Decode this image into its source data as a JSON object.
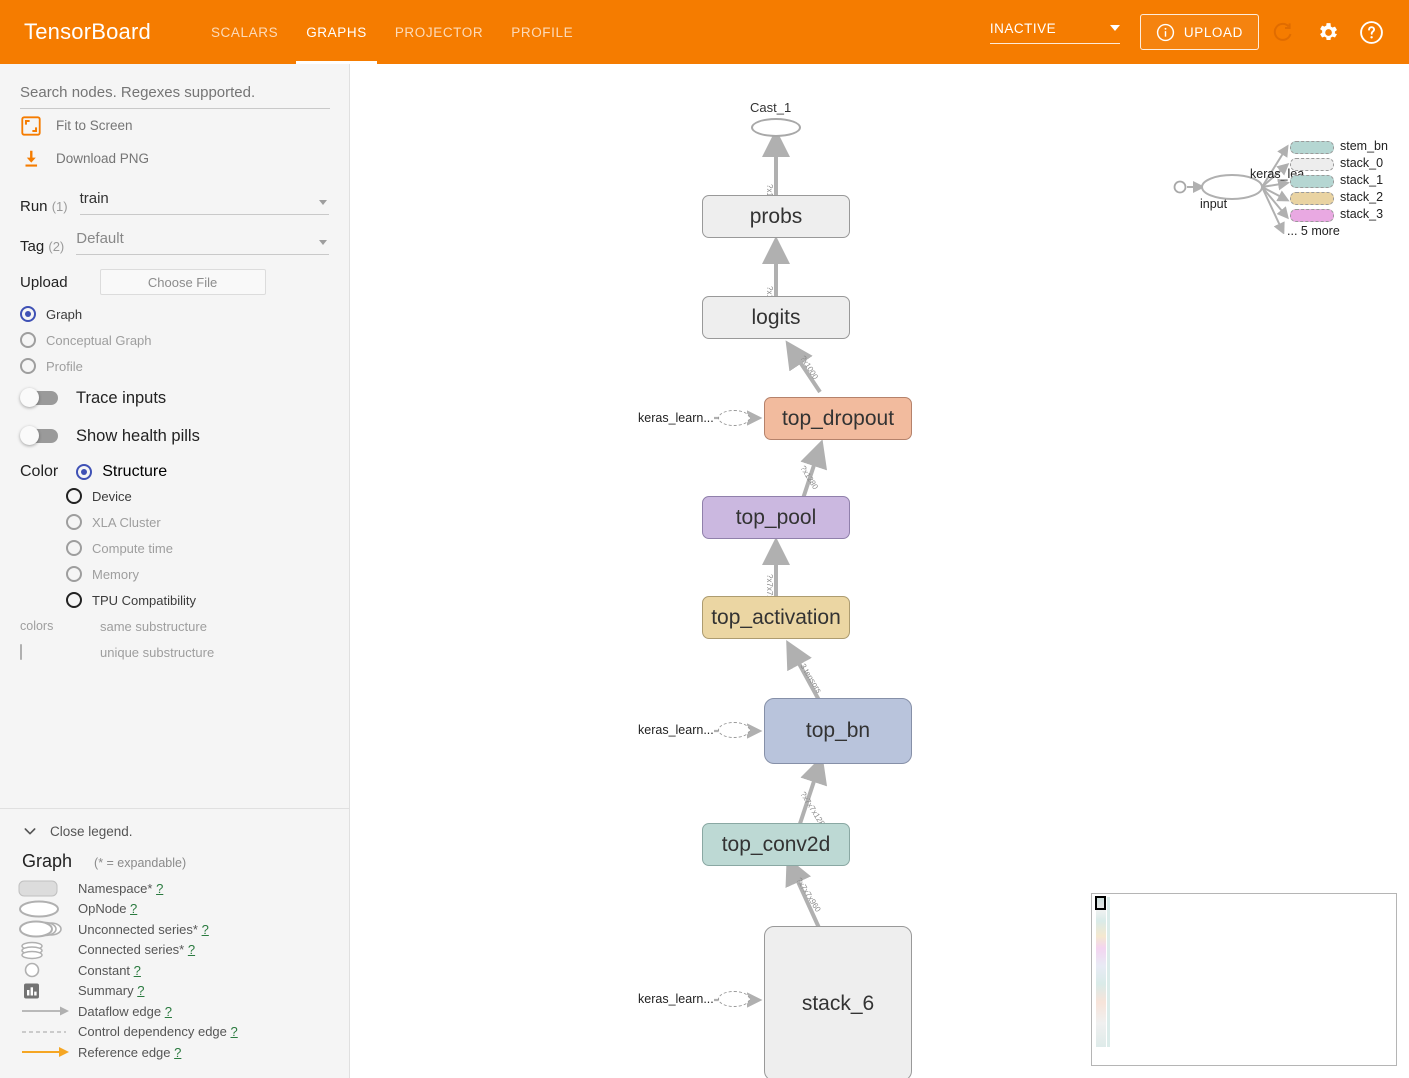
{
  "header": {
    "logo": "TensorBoard",
    "tabs": [
      {
        "label": "SCALARS",
        "active": false
      },
      {
        "label": "GRAPHS",
        "active": true
      },
      {
        "label": "PROJECTOR",
        "active": false
      },
      {
        "label": "PROFILE",
        "active": false
      }
    ],
    "status_select": "INACTIVE",
    "upload_label": "UPLOAD",
    "icons": [
      "info-icon",
      "refresh-icon",
      "gear-icon",
      "help-icon"
    ],
    "accent_color": "#f57c00"
  },
  "sidebar": {
    "search_placeholder": "Search nodes. Regexes supported.",
    "search_value": "",
    "fit_to_screen": "Fit to Screen",
    "download_png": "Download PNG",
    "run": {
      "label": "Run",
      "count": "(1)",
      "value": "train"
    },
    "tag": {
      "label": "Tag",
      "count": "(2)",
      "value": "Default"
    },
    "upload": {
      "title": "Upload",
      "choose_file": "Choose File"
    },
    "source_options": [
      {
        "label": "Graph",
        "checked": true,
        "enabled": true
      },
      {
        "label": "Conceptual Graph",
        "checked": false,
        "enabled": false
      },
      {
        "label": "Profile",
        "checked": false,
        "enabled": false
      }
    ],
    "toggles": [
      {
        "label": "Trace inputs",
        "on": false
      },
      {
        "label": "Show health pills",
        "on": false
      }
    ],
    "color": {
      "title": "Color",
      "options": [
        {
          "label": "Structure",
          "checked": true,
          "enabled": true
        },
        {
          "label": "Device",
          "checked": false,
          "enabled": true
        },
        {
          "label": "XLA Cluster",
          "checked": false,
          "enabled": false
        },
        {
          "label": "Compute time",
          "checked": false,
          "enabled": false
        },
        {
          "label": "Memory",
          "checked": false,
          "enabled": false
        },
        {
          "label": "TPU Compatibility",
          "checked": false,
          "enabled": true
        }
      ],
      "swatch_key": "colors",
      "same_substructure": "same substructure",
      "unique_substructure": "unique substructure"
    }
  },
  "legend": {
    "close_label": "Close legend.",
    "title": "Graph",
    "subtitle": "(* = expandable)",
    "items": [
      {
        "icon": "namespace-icon",
        "text": "Namespace*",
        "help": "?"
      },
      {
        "icon": "opnode-icon",
        "text": "OpNode",
        "help": "?"
      },
      {
        "icon": "unconnected-series-icon",
        "text": "Unconnected series*",
        "help": "?"
      },
      {
        "icon": "connected-series-icon",
        "text": "Connected series*",
        "help": "?"
      },
      {
        "icon": "constant-icon",
        "text": "Constant",
        "help": "?"
      },
      {
        "icon": "summary-icon",
        "text": "Summary",
        "help": "?"
      },
      {
        "icon": "dataflow-edge-icon",
        "text": "Dataflow edge",
        "help": "?"
      },
      {
        "icon": "control-dependency-edge-icon",
        "text": "Control dependency edge",
        "help": "?"
      },
      {
        "icon": "reference-edge-icon",
        "text": "Reference edge",
        "help": "?"
      }
    ]
  },
  "graph": {
    "nodes": [
      {
        "id": "cast_1",
        "label": "Cast_1",
        "type": "op",
        "color": "#ffffff"
      },
      {
        "id": "probs",
        "label": "probs",
        "type": "namespace",
        "color": "#eeeeee"
      },
      {
        "id": "logits",
        "label": "logits",
        "type": "namespace",
        "color": "#eeeeee"
      },
      {
        "id": "top_dropout",
        "label": "top_dropout",
        "type": "namespace",
        "color": "#f2bb9e"
      },
      {
        "id": "top_pool",
        "label": "top_pool",
        "type": "namespace",
        "color": "#cbb8e0"
      },
      {
        "id": "top_activation",
        "label": "top_activation",
        "type": "namespace",
        "color": "#ebd6a3"
      },
      {
        "id": "top_bn",
        "label": "top_bn",
        "type": "namespace",
        "color": "#b9c4dc"
      },
      {
        "id": "top_conv2d",
        "label": "top_conv2d",
        "type": "namespace",
        "color": "#bdd9d4"
      },
      {
        "id": "stack_6",
        "label": "stack_6",
        "type": "namespace",
        "color": "#eeeeee"
      }
    ],
    "edge_labels": [
      "?x1000",
      "?x1000",
      "?x1000",
      "?x1280",
      "?x1280",
      "?x7x7x1280",
      "3 tensors",
      "?x7x7x1280",
      "?x7x7x960"
    ],
    "input_stubs": [
      {
        "label": "keras_learn...",
        "target": "top_dropout"
      },
      {
        "label": "keras_learn...",
        "target": "top_bn"
      },
      {
        "label": "keras_learn...",
        "target": "stack_6"
      }
    ]
  },
  "aux_panel": {
    "input_label": "input",
    "hub_label": "keras_lea...",
    "items": [
      {
        "label": "stem_bn",
        "color": "#b5d6d2"
      },
      {
        "label": "stack_0",
        "color": "#ededed"
      },
      {
        "label": "stack_1",
        "color": "#b5d6d2"
      },
      {
        "label": "stack_2",
        "color": "#e9d3a2"
      },
      {
        "label": "stack_3",
        "color": "#e9a9e2"
      }
    ],
    "more_label": "... 5 more"
  },
  "minimap": {
    "name": "graph-minimap"
  }
}
